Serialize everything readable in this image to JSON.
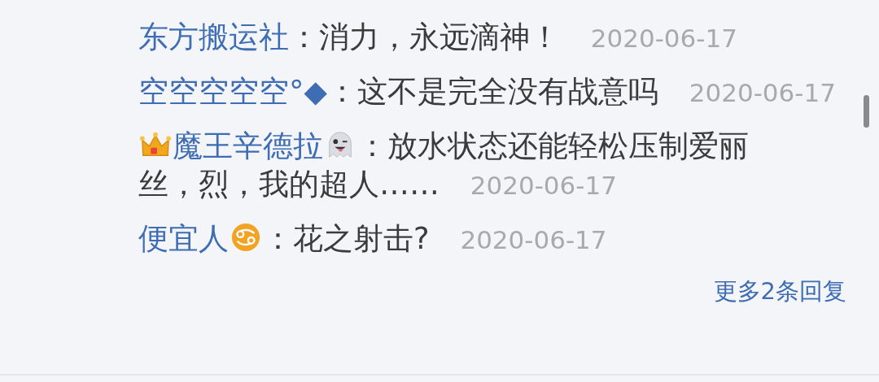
{
  "comments": [
    {
      "user": "东方搬运社",
      "text_lines": [
        "：消力，永远滴神！"
      ],
      "date": "2020-06-17"
    },
    {
      "user": "空空空空空°◆",
      "text_lines": [
        "：这不是完全没有战意吗"
      ],
      "date": "2020-06-17"
    },
    {
      "user": "魔王辛德拉",
      "badges_before": [
        {
          "kind": "crown"
        }
      ],
      "badges_after": [
        {
          "kind": "ghost"
        }
      ],
      "text_lines": [
        "：放水状态还能轻松压制爱丽",
        "丝，烈，我的超人……"
      ],
      "date": "2020-06-17"
    },
    {
      "user": "便宜人",
      "badges_after": [
        {
          "kind": "zodiac"
        }
      ],
      "text_lines": [
        "：花之射击?"
      ],
      "date": "2020-06-17"
    }
  ],
  "more_replies": "更多2条回复"
}
